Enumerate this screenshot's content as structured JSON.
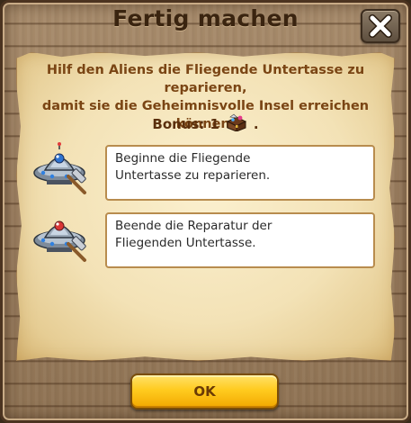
{
  "dialog": {
    "title": "Fertig machen",
    "close_icon": "close-x-icon",
    "description_lines": [
      "Hilf den Aliens die Fliegende Untertasse zu reparieren,",
      "damit sie die Geheimnisvolle Insel erreichen können."
    ],
    "bonus": {
      "label": "Bonus:",
      "amount": "1",
      "icon": "treasure-chest-icon",
      "suffix": "."
    },
    "tasks": [
      {
        "icon": "ufo-hammer-icon",
        "lines": [
          "Beginne die Fliegende",
          "Untertasse zu reparieren."
        ]
      },
      {
        "icon": "ufo-hammer-icon",
        "lines": [
          "Beende die Reparatur der",
          "Fliegenden Untertasse."
        ]
      }
    ],
    "ok_label": "OK"
  },
  "colors": {
    "wood_frame": "#9c7f60",
    "parchment": "#f3e2b6",
    "description_text": "#7a4514",
    "ok_button": "#ffcb1f"
  }
}
